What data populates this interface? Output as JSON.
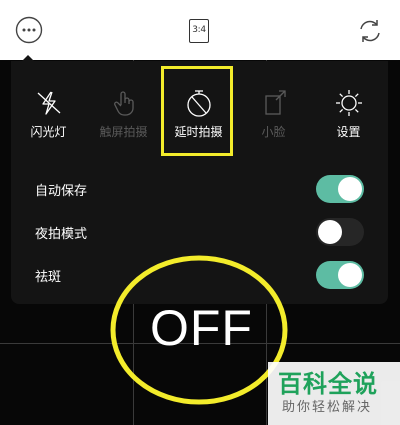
{
  "toolbar": {
    "more_icon": "more-dots-icon",
    "ratio_label": "3:4",
    "switch_icon": "camera-switch-icon"
  },
  "menu": {
    "options": [
      {
        "label": "闪光灯",
        "icon": "flash-off-icon",
        "state": "normal"
      },
      {
        "label": "触屏拍摄",
        "icon": "touch-icon",
        "state": "dim"
      },
      {
        "label": "延时拍摄",
        "icon": "timer-icon",
        "state": "normal"
      },
      {
        "label": "小脸",
        "icon": "small-face-icon",
        "state": "dim"
      },
      {
        "label": "设置",
        "icon": "gear-icon",
        "state": "normal"
      }
    ],
    "toggles": [
      {
        "label": "自动保存",
        "on": true
      },
      {
        "label": "夜拍模式",
        "on": false
      },
      {
        "label": "祛斑",
        "on": true
      }
    ]
  },
  "overlay": {
    "timer_text": "OFF",
    "highlight_color": "#f3ec2b"
  },
  "watermark": {
    "title": "百科全说",
    "subtitle": "助你轻松解决"
  },
  "colors": {
    "toggle_on": "#5dbca3",
    "panel_bg": "#141414",
    "highlight": "#f3ec2b",
    "watermark_green": "#1fa25b"
  }
}
